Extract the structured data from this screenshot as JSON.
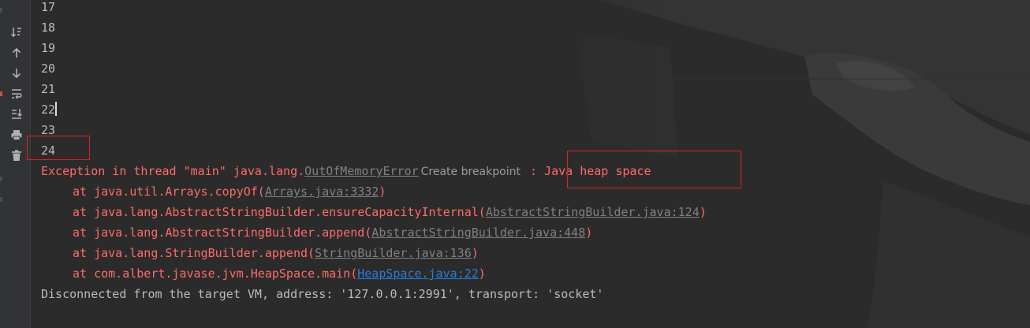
{
  "toolbar": {
    "icons": [
      "sort-icon",
      "up-arrow-icon",
      "down-arrow-icon",
      "soft-wrap-icon",
      "scroll-to-end-icon",
      "print-icon",
      "trash-icon"
    ]
  },
  "console": {
    "counter_lines": [
      "17",
      "18",
      "19",
      "20",
      "21",
      "22",
      "23",
      "24"
    ],
    "exception": {
      "prefix": "Exception in thread \"main\" java.lang.",
      "error_class": "OutOfMemoryError",
      "hint": "Create breakpoint",
      "message": " : Java heap space"
    },
    "stack": [
      {
        "at": "at java.util.Arrays.copyOf(",
        "link": "Arrays.java:3332",
        "end": ")"
      },
      {
        "at": "at java.lang.AbstractStringBuilder.ensureCapacityInternal(",
        "link": "AbstractStringBuilder.java:124",
        "end": ")"
      },
      {
        "at": "at java.lang.AbstractStringBuilder.append(",
        "link": "AbstractStringBuilder.java:448",
        "end": ")"
      },
      {
        "at": "at java.lang.StringBuilder.append(",
        "link": "StringBuilder.java:136",
        "end": ")"
      },
      {
        "at": "at com.albert.javase.jvm.HeapSpace.main(",
        "link": "HeapSpace.java:22",
        "end": ")"
      }
    ],
    "disconnect": "Disconnected from the target VM, address: '127.0.0.1:2991', transport: 'socket'"
  },
  "colors": {
    "background": "#2b2b2b",
    "stdout": "#bbbbbb",
    "stderr": "#ff6b68",
    "link_gray": "#808080",
    "link_blue": "#287bde",
    "annotation_red": "#e02020"
  }
}
